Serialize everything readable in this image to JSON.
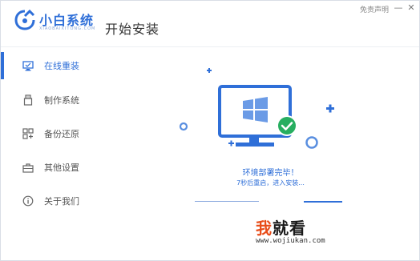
{
  "header": {
    "brand": "小白系统",
    "brand_sub": "XIAOBAIXITONG.COM",
    "title": "开始安装",
    "link_label": "免责声明",
    "minimize_glyph": "—",
    "close_glyph": "✕"
  },
  "sidebar": {
    "items": [
      {
        "label": "在线重装",
        "icon": "monitor-icon",
        "active": true
      },
      {
        "label": "制作系统",
        "icon": "usb-icon",
        "active": false
      },
      {
        "label": "备份还原",
        "icon": "backup-icon",
        "active": false
      },
      {
        "label": "其他设置",
        "icon": "toolbox-icon",
        "active": false
      },
      {
        "label": "关于我们",
        "icon": "info-icon",
        "active": false
      }
    ]
  },
  "main": {
    "status_title": "环境部署完毕！",
    "status_sub": "7秒后重启，进入安装...",
    "illustration": "monitor-windows-check-icon"
  },
  "watermark": {
    "big_prefix": "我",
    "big_rest": "就看",
    "url": "www.wojiukan.com"
  },
  "colors": {
    "accent": "#2f6fd8",
    "success": "#27ae60",
    "watermark_orange": "#e84d1a"
  }
}
